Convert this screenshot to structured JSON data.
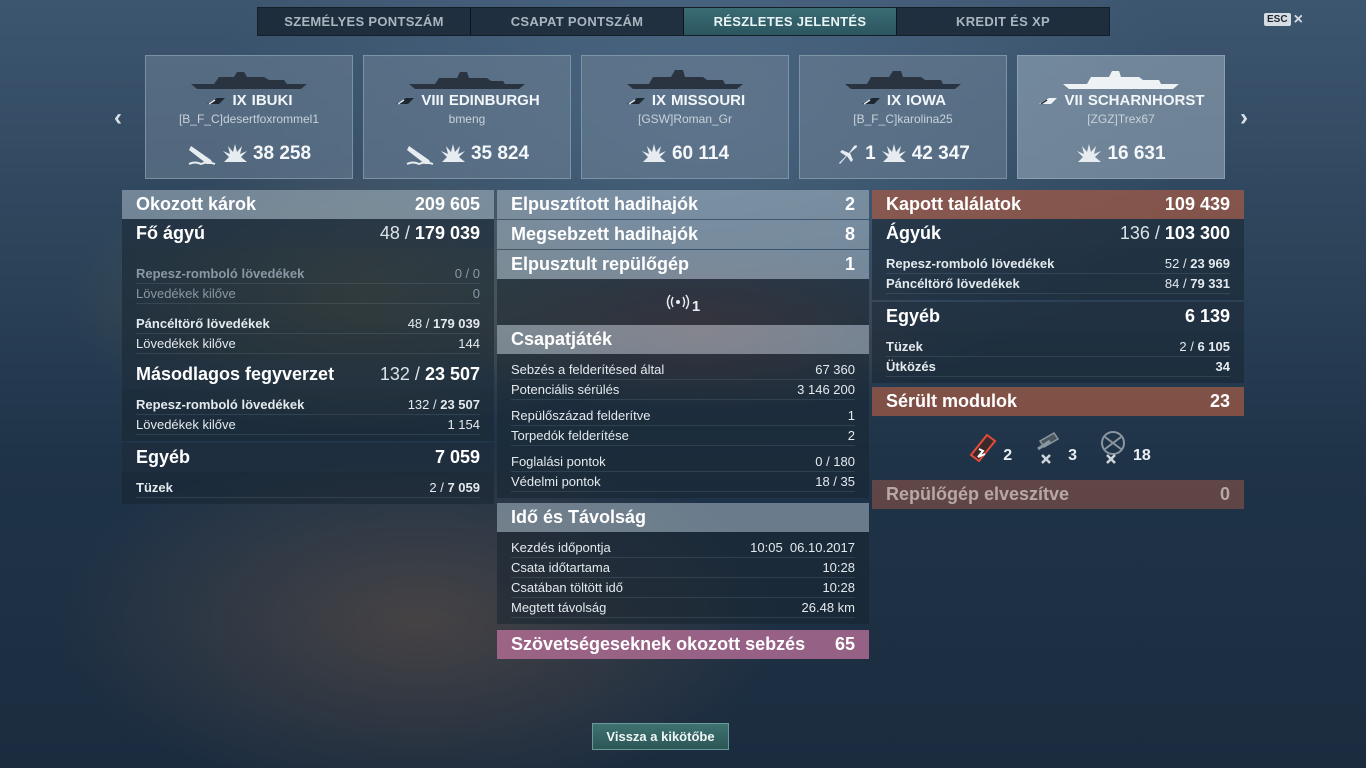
{
  "tabs": [
    "SZEMÉLYES PONTSZÁM",
    "CSAPAT PONTSZÁM",
    "RÉSZLETES JELENTÉS",
    "KREDIT ÉS XP"
  ],
  "esc": {
    "key": "ESC",
    "close": "×"
  },
  "nav": {
    "left": "‹",
    "right": "›"
  },
  "cards": [
    {
      "tier": "IX",
      "name": "IBUKI",
      "player": "[B_F_C]desertfoxrommel1",
      "kills": "",
      "damage": "38 258",
      "icon": "sunk-ship-icon"
    },
    {
      "tier": "VIII",
      "name": "EDINBURGH",
      "player": "bmeng",
      "kills": "",
      "damage": "35 824",
      "icon": "sunk-ship-icon"
    },
    {
      "tier": "IX",
      "name": "MISSOURI",
      "player": "[GSW]Roman_Gr",
      "kills": "",
      "damage": "60 114",
      "icon": ""
    },
    {
      "tier": "IX",
      "name": "IOWA",
      "player": "[B_F_C]karolina25",
      "kills": "1",
      "damage": "42 347",
      "icon": "plane-shot-icon"
    },
    {
      "tier": "VII",
      "name": "SCHARNHORST",
      "player": "[ZGZ]Trex67",
      "kills": "",
      "damage": "16 631",
      "icon": ""
    }
  ],
  "left": {
    "damage_dealt": {
      "label": "Okozott károk",
      "value": "209 605"
    },
    "main_battery": {
      "label": "Fő ágyú",
      "hits": "48",
      "value": "179 039"
    },
    "he_label": "Repesz-romboló lövedékek",
    "he_value": "0 / 0",
    "he_fired_label": "Lövedékek kilőve",
    "he_fired": "0",
    "ap_label": "Páncéltörő lövedékek",
    "ap_hits": "48",
    "ap_value": "179 039",
    "ap_fired_label": "Lövedékek kilőve",
    "ap_fired": "144",
    "secondary": {
      "label": "Másodlagos fegyverzet",
      "hits": "132",
      "value": "23 507"
    },
    "sec_he_label": "Repesz-romboló lövedékek",
    "sec_he_hits": "132",
    "sec_he_value": "23 507",
    "sec_fired_label": "Lövedékek kilőve",
    "sec_fired": "1 154",
    "other": {
      "label": "Egyéb",
      "value": "7 059"
    },
    "fire_label": "Tüzek",
    "fire_hits": "2",
    "fire_value": "7 059"
  },
  "middle": {
    "ships_destroyed": {
      "label": "Elpusztított hadihajók",
      "value": "2"
    },
    "ships_damaged": {
      "label": "Megsebzett hadihajók",
      "value": "8"
    },
    "planes_destroyed": {
      "label": "Elpusztult repülőgép",
      "value": "1"
    },
    "spotted_count": "1",
    "teamplay": {
      "label": "Csapatjáték",
      "rows": [
        {
          "label": "Sebzés a felderítésed által",
          "value": "67 360"
        },
        {
          "label": "Potenciális sérülés",
          "value": "3 146 200"
        },
        {
          "label": "Repülőszázad felderítve",
          "value": "1"
        },
        {
          "label": "Torpedók felderítése",
          "value": "2"
        },
        {
          "label": "Foglalási pontok",
          "value": "0 / 180"
        },
        {
          "label": "Védelmi pontok",
          "value": "18 / 35"
        }
      ]
    },
    "time": {
      "label": "Idő és Távolság",
      "rows": [
        {
          "label": "Kezdés időpontja",
          "value": "10:05  06.10.2017"
        },
        {
          "label": "Csata időtartama",
          "value": "10:28"
        },
        {
          "label": "Csatában töltött idő",
          "value": "10:28"
        },
        {
          "label": "Megtett távolság",
          "value": "26.48 km"
        }
      ]
    },
    "ally_damage": {
      "label": "Szövetségeseknek okozott sebzés",
      "value": "65"
    }
  },
  "right": {
    "received": {
      "label": "Kapott találatok",
      "value": "109 439"
    },
    "guns": {
      "label": "Ágyúk",
      "hits": "136",
      "value": "103 300"
    },
    "he_label": "Repesz-romboló lövedékek",
    "he_hits": "52",
    "he_value": "23 969",
    "ap_label": "Páncéltörő lövedékek",
    "ap_hits": "84",
    "ap_value": "79 331",
    "other": {
      "label": "Egyéb",
      "value": "6 139"
    },
    "fire_label": "Tüzek",
    "fire_hits": "2",
    "fire_value": "6 105",
    "ram_label": "Ütközés",
    "ram_value": "34",
    "modules": {
      "label": "Sérült modulok",
      "value": "23"
    },
    "mod_counts": [
      "2",
      "3",
      "18"
    ],
    "planes_lost": {
      "label": "Repülőgép elveszítve",
      "value": "0"
    }
  },
  "back_button": "Vissza a kikötőbe",
  "colors": {
    "active_tab": "#3a6b74",
    "received_header": "#a05a46",
    "ally_damage": "#b46e96"
  }
}
